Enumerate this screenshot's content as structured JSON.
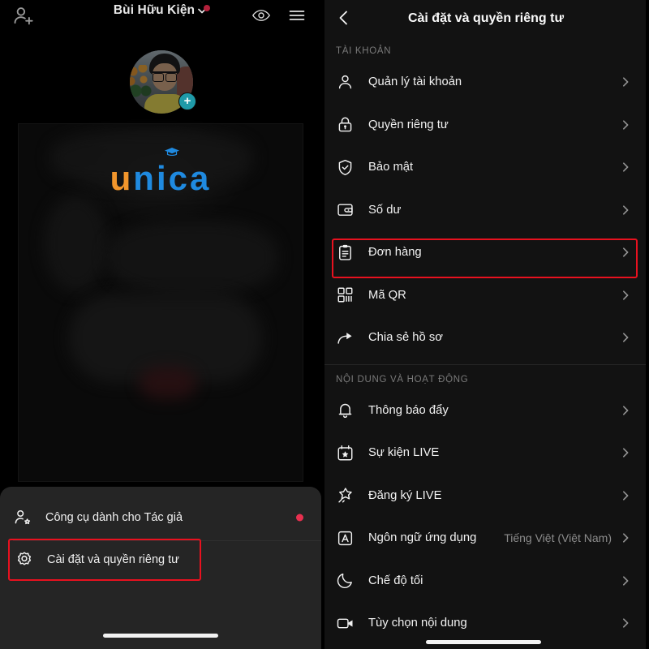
{
  "left_panel": {
    "topbar": {
      "add_friend_icon": "person-add-icon",
      "username": "Bùi Hữu Kiện",
      "caret_icon": "chevron-down-icon",
      "notification_dot": true,
      "eye_icon": "eye-icon",
      "menu_icon": "hamburger-menu-icon"
    },
    "profile": {
      "avatar": "user-avatar",
      "add_badge_label": "+"
    },
    "logo": {
      "part_orange": "u",
      "part_blue": "nica",
      "full_text": "unica",
      "colors": {
        "orange": "#f2962c",
        "blue": "#1f8ae0"
      }
    },
    "sheet": {
      "rows": [
        {
          "icon": "person-star-icon",
          "label": "Công cụ dành cho Tác giả",
          "has_dot": true,
          "highlighted": false
        },
        {
          "icon": "gear-icon",
          "label": "Cài đặt và quyền riêng tư",
          "has_dot": false,
          "highlighted": true
        }
      ],
      "highlight_color": "#e8111f"
    },
    "home_indicator": true
  },
  "right_panel": {
    "header": {
      "back_icon": "chevron-left-icon",
      "title": "Cài đặt và quyền riêng tư"
    },
    "sections": [
      {
        "label": "TÀI KHOẢN",
        "items": [
          {
            "icon": "person-icon",
            "label": "Quản lý tài khoản",
            "value": "",
            "highlighted": false
          },
          {
            "icon": "lock-icon",
            "label": "Quyền riêng tư",
            "value": "",
            "highlighted": false
          },
          {
            "icon": "shield-check-icon",
            "label": "Bảo mật",
            "value": "",
            "highlighted": false
          },
          {
            "icon": "wallet-icon",
            "label": "Số dư",
            "value": "",
            "highlighted": false
          },
          {
            "icon": "clipboard-icon",
            "label": "Đơn hàng",
            "value": "",
            "highlighted": true
          },
          {
            "icon": "qr-code-icon",
            "label": "Mã QR",
            "value": "",
            "highlighted": false
          },
          {
            "icon": "share-arrow-icon",
            "label": "Chia sẻ hồ sơ",
            "value": "",
            "highlighted": false
          }
        ]
      },
      {
        "label": "NỘI DUNG VÀ HOẠT ĐỘNG",
        "items": [
          {
            "icon": "bell-icon",
            "label": "Thông báo đẩy",
            "value": "",
            "highlighted": false
          },
          {
            "icon": "calendar-star-icon",
            "label": "Sự kiện LIVE",
            "value": "",
            "highlighted": false
          },
          {
            "icon": "live-star-icon",
            "label": "Đăng ký LIVE",
            "value": "",
            "highlighted": false
          },
          {
            "icon": "language-a-icon",
            "label": "Ngôn ngữ ứng dụng",
            "value": "Tiếng Việt (Việt Nam)",
            "highlighted": false
          },
          {
            "icon": "moon-icon",
            "label": "Chế độ tối",
            "value": "",
            "highlighted": false
          },
          {
            "icon": "video-camera-icon",
            "label": "Tùy chọn nội dung",
            "value": "",
            "highlighted": false
          }
        ]
      }
    ],
    "chevron_icon": "chevron-right-icon",
    "highlight_color": "#e8111f",
    "home_indicator": true
  }
}
